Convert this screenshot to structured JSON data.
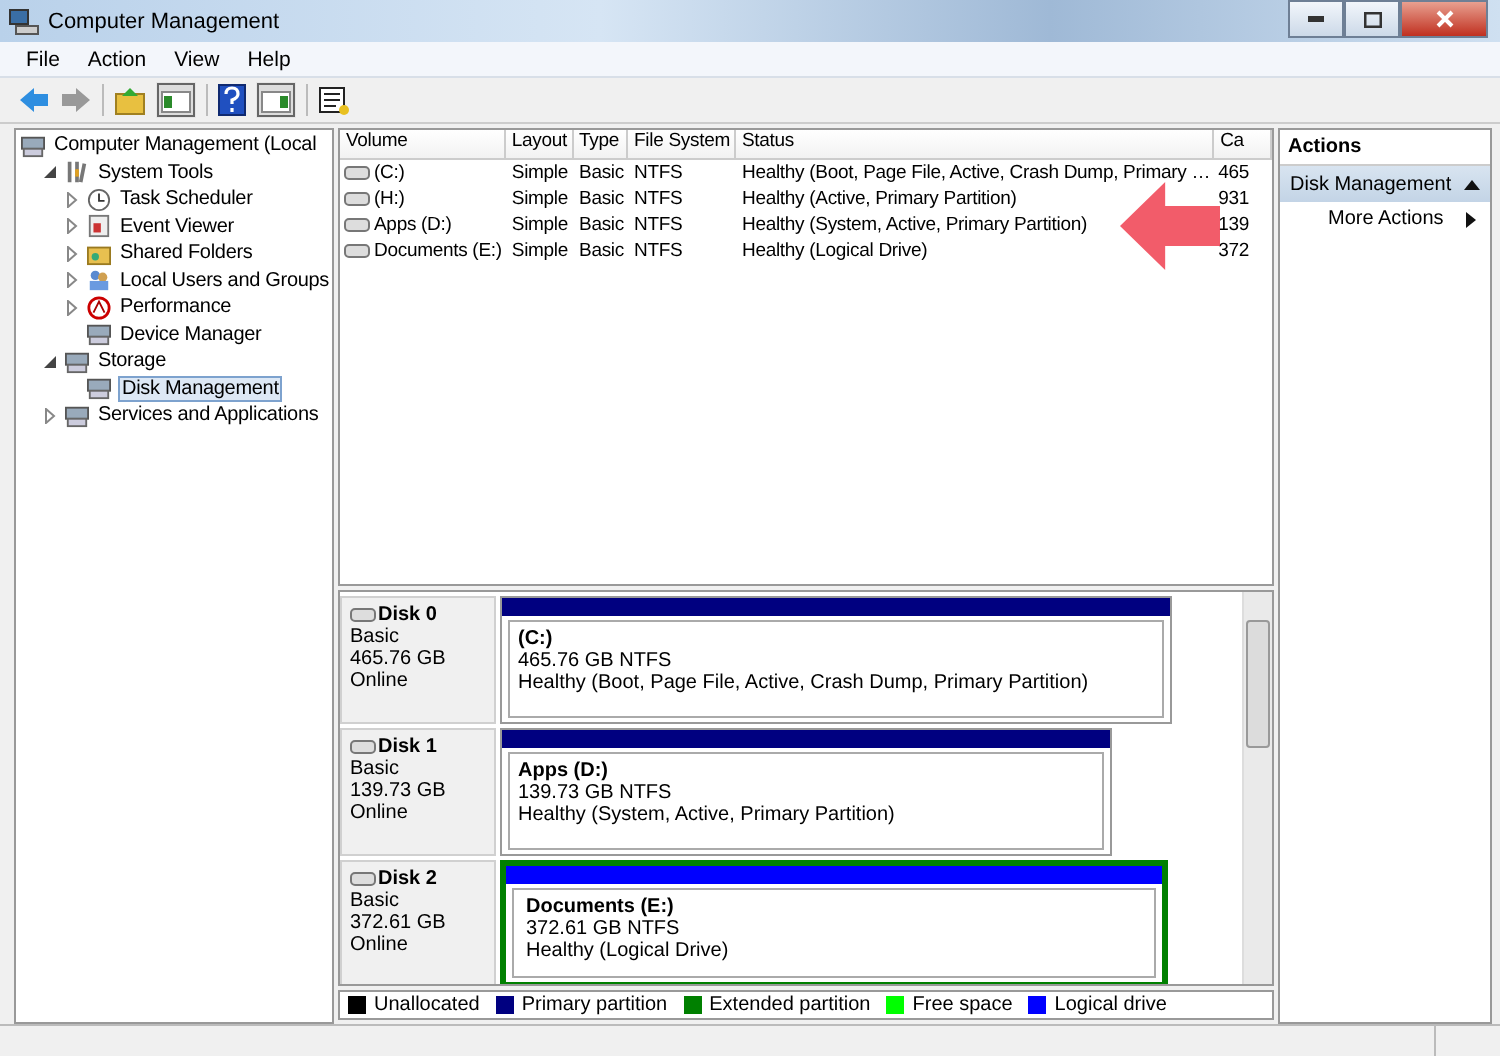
{
  "window": {
    "title": "Computer Management"
  },
  "menu": [
    "File",
    "Action",
    "View",
    "Help"
  ],
  "tree": [
    {
      "label": "Computer Management (Local",
      "children": [
        {
          "label": "System Tools",
          "expanded": true,
          "children": [
            {
              "label": "Task Scheduler",
              "expanded": false
            },
            {
              "label": "Event Viewer",
              "expanded": false
            },
            {
              "label": "Shared Folders",
              "expanded": false
            },
            {
              "label": "Local Users and Groups",
              "expanded": false
            },
            {
              "label": "Performance",
              "expanded": false
            },
            {
              "label": "Device Manager"
            }
          ]
        },
        {
          "label": "Storage",
          "expanded": true,
          "children": [
            {
              "label": "Disk Management",
              "selected": true
            }
          ]
        },
        {
          "label": "Services and Applications",
          "expanded": false
        }
      ]
    }
  ],
  "table": {
    "columns": [
      "Volume",
      "Layout",
      "Type",
      "File System",
      "Status",
      "Ca"
    ],
    "rows": [
      [
        "(C:)",
        "Simple",
        "Basic",
        "NTFS",
        "Healthy (Boot, Page File, Active, Crash Dump, Primary …",
        "465"
      ],
      [
        "(H:)",
        "Simple",
        "Basic",
        "NTFS",
        "Healthy (Active, Primary Partition)",
        "931"
      ],
      [
        "Apps (D:)",
        "Simple",
        "Basic",
        "NTFS",
        "Healthy (System, Active, Primary Partition)",
        "139"
      ],
      [
        "Documents (E:)",
        "Simple",
        "Basic",
        "NTFS",
        "Healthy (Logical Drive)",
        "372"
      ]
    ]
  },
  "disks": [
    {
      "name": "Disk 0",
      "type": "Basic",
      "size": "465.76 GB",
      "state": "Online",
      "partition": {
        "kind": "primary",
        "label": "(C:)",
        "size": "465.76 GB NTFS",
        "status": "Healthy (Boot, Page File, Active, Crash Dump, Primary Partition)"
      }
    },
    {
      "name": "Disk 1",
      "type": "Basic",
      "size": "139.73 GB",
      "state": "Online",
      "partition": {
        "kind": "primary",
        "label": "Apps  (D:)",
        "size": "139.73 GB NTFS",
        "status": "Healthy (System, Active, Primary Partition)"
      }
    },
    {
      "name": "Disk 2",
      "type": "Basic",
      "size": "372.61 GB",
      "state": "Online",
      "partition": {
        "kind": "logical",
        "label": "Documents  (E:)",
        "size": "372.61 GB NTFS",
        "status": "Healthy (Logical Drive)"
      }
    }
  ],
  "legend": [
    {
      "label": "Unallocated",
      "color": "#000000"
    },
    {
      "label": "Primary partition",
      "color": "#000080"
    },
    {
      "label": "Extended partition",
      "color": "#008000"
    },
    {
      "label": "Free space",
      "color": "#00ff00"
    },
    {
      "label": "Logical drive",
      "color": "#0000ff"
    }
  ],
  "actions": {
    "title": "Actions",
    "section": "Disk Management",
    "items": [
      "More Actions"
    ]
  }
}
